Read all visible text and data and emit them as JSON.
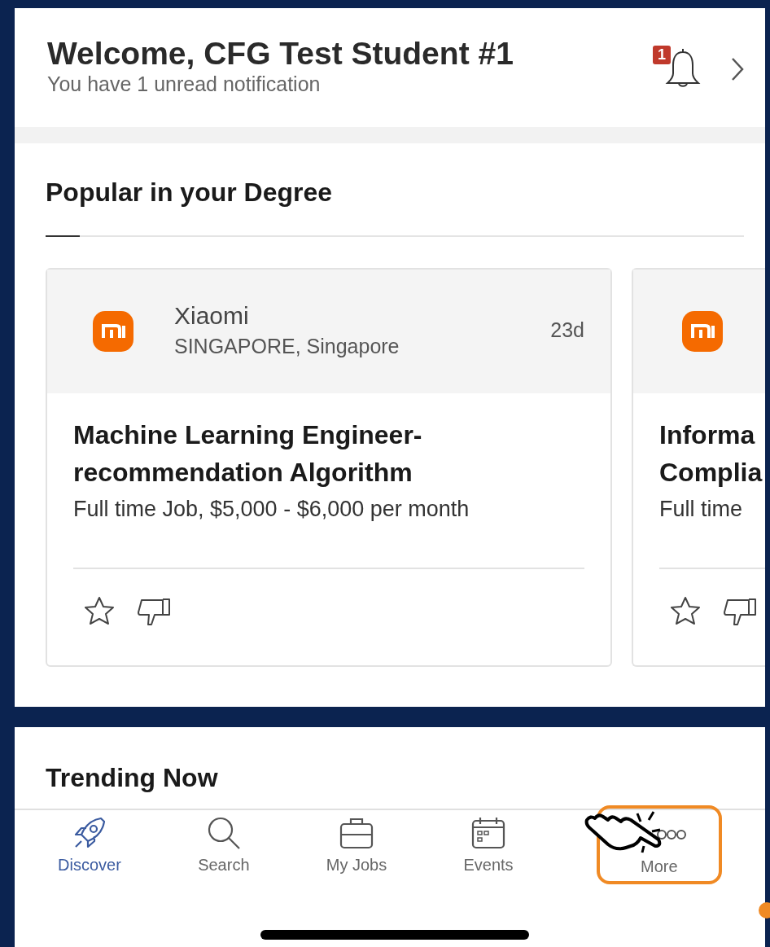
{
  "header": {
    "title": "Welcome, CFG Test Student #1",
    "subtitle": "You have 1 unread notification",
    "notification_count": "1"
  },
  "popular": {
    "title": "Popular in your Degree",
    "cards": [
      {
        "company": "Xiaomi",
        "location": "SINGAPORE, Singapore",
        "age": "23d",
        "title": "Machine Learning Engineer-\nrecommendation Algorithm",
        "details": "Full time Job, $5,000 - $6,000 per month",
        "partial": false
      },
      {
        "title": "Informa\nComplia",
        "details": "Full time",
        "partial": true
      }
    ]
  },
  "trending": {
    "title": "Trending Now"
  },
  "nav": [
    {
      "label": "Discover",
      "selected": true,
      "highlighted": false
    },
    {
      "label": "Search",
      "selected": false,
      "highlighted": false
    },
    {
      "label": "My Jobs",
      "selected": false,
      "highlighted": false
    },
    {
      "label": "Events",
      "selected": false,
      "highlighted": false
    },
    {
      "label": "More",
      "selected": false,
      "highlighted": true
    }
  ]
}
